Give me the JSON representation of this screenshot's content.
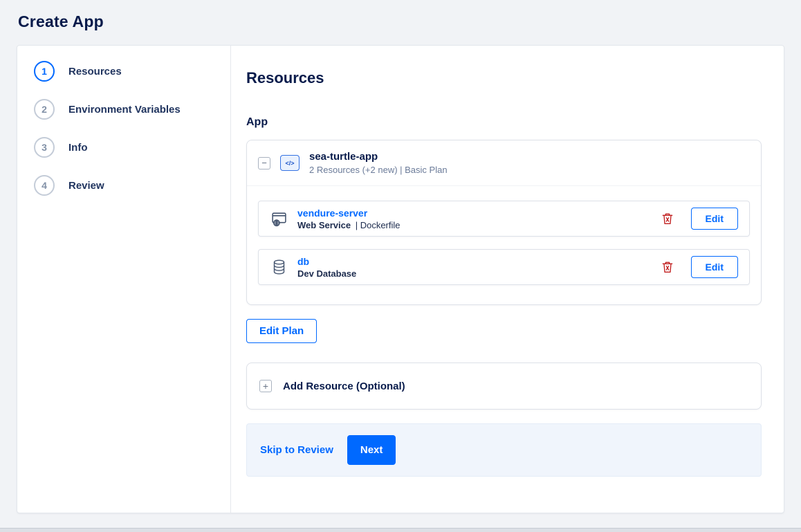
{
  "page": {
    "title": "Create App"
  },
  "stepper": {
    "steps": [
      {
        "number": "1",
        "label": "Resources"
      },
      {
        "number": "2",
        "label": "Environment Variables"
      },
      {
        "number": "3",
        "label": "Info"
      },
      {
        "number": "4",
        "label": "Review"
      }
    ]
  },
  "content": {
    "heading": "Resources",
    "section_label": "App",
    "app": {
      "collapse_icon": "−",
      "icon_text": "</>",
      "name": "sea-turtle-app",
      "summary": "2 Resources (+2 new) | Basic Plan",
      "resources": [
        {
          "name": "vendure-server",
          "type_primary": "Web Service",
          "type_secondary": "| Dockerfile",
          "edit_label": "Edit"
        },
        {
          "name": "db",
          "type_primary": "Dev Database",
          "type_secondary": "",
          "edit_label": "Edit"
        }
      ]
    },
    "edit_plan_label": "Edit Plan",
    "add_resource": {
      "icon": "+",
      "label": "Add Resource (Optional)"
    },
    "footer": {
      "skip_label": "Skip to Review",
      "next_label": "Next"
    }
  },
  "colors": {
    "accent": "#0069ff",
    "danger": "#c11f1f",
    "heading": "#081b4b",
    "muted": "#6b7b99"
  }
}
